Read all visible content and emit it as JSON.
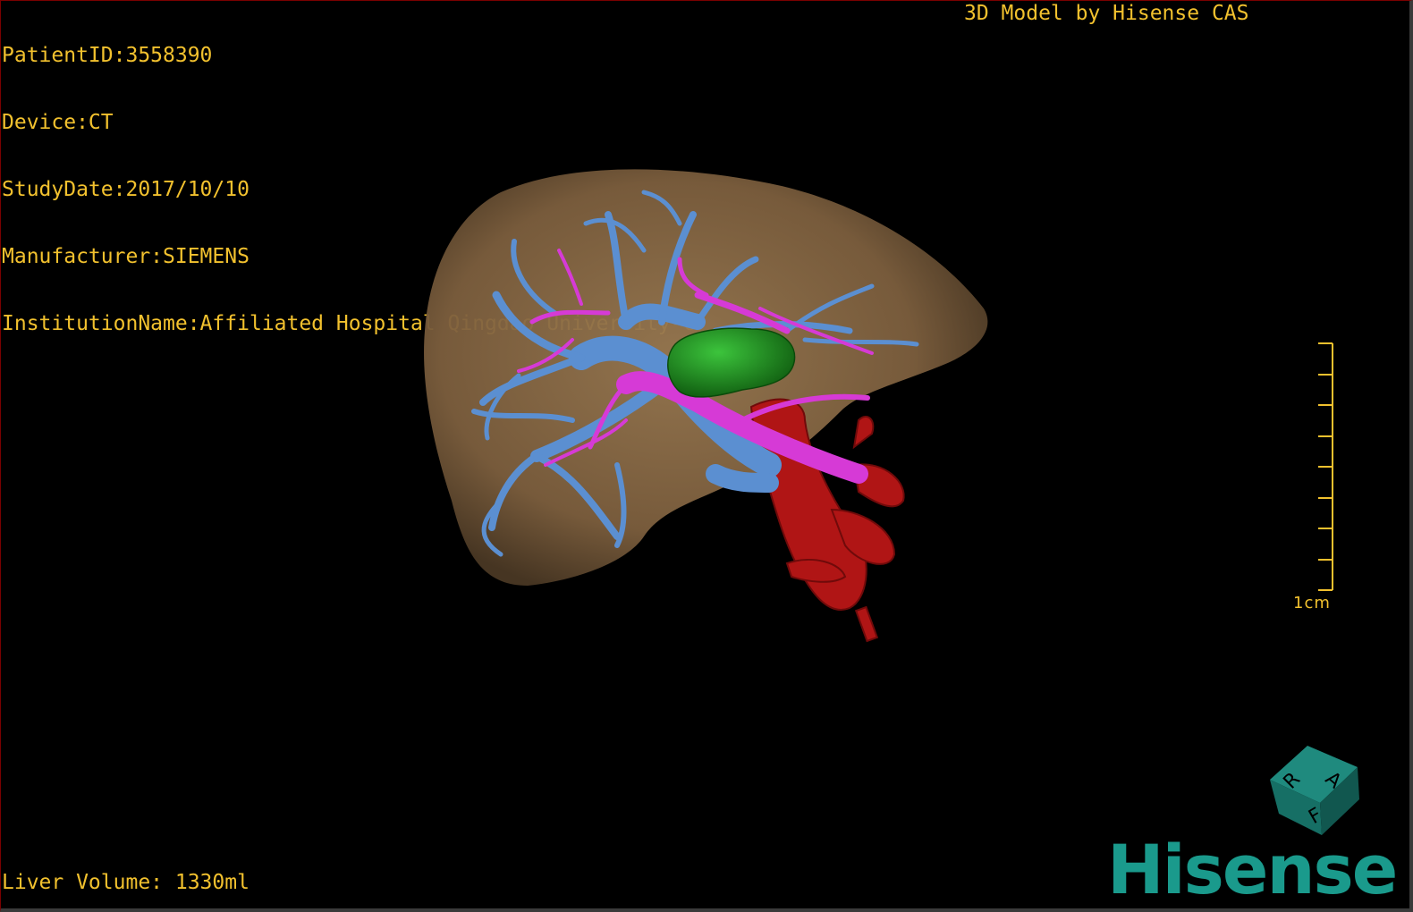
{
  "header": {
    "patient_id": "PatientID:3558390",
    "device": "Device:CT",
    "study_date": "StudyDate:2017/10/10",
    "manufacturer": "Manufacturer:SIEMENS",
    "institution": "InstitutionName:Affiliated Hospital Qingdao University-C",
    "model_credit": "3D Model by Hisense CAS"
  },
  "footer": {
    "liver_volume": "Liver Volume: 1330ml"
  },
  "scale_bar": {
    "label": "1cm"
  },
  "orientation_cube": {
    "faces": [
      "R",
      "A",
      "F"
    ]
  },
  "brand": {
    "logo": "Hisense"
  },
  "colors": {
    "text": "#f2c12e",
    "liver": "#8a6a45",
    "portal_vein": "#5b8fd1",
    "hepatic_artery": "#d63ad6",
    "tumor": "#1f8a1f",
    "vena_cava": "#b01515",
    "brand": "#1a9a8c"
  }
}
